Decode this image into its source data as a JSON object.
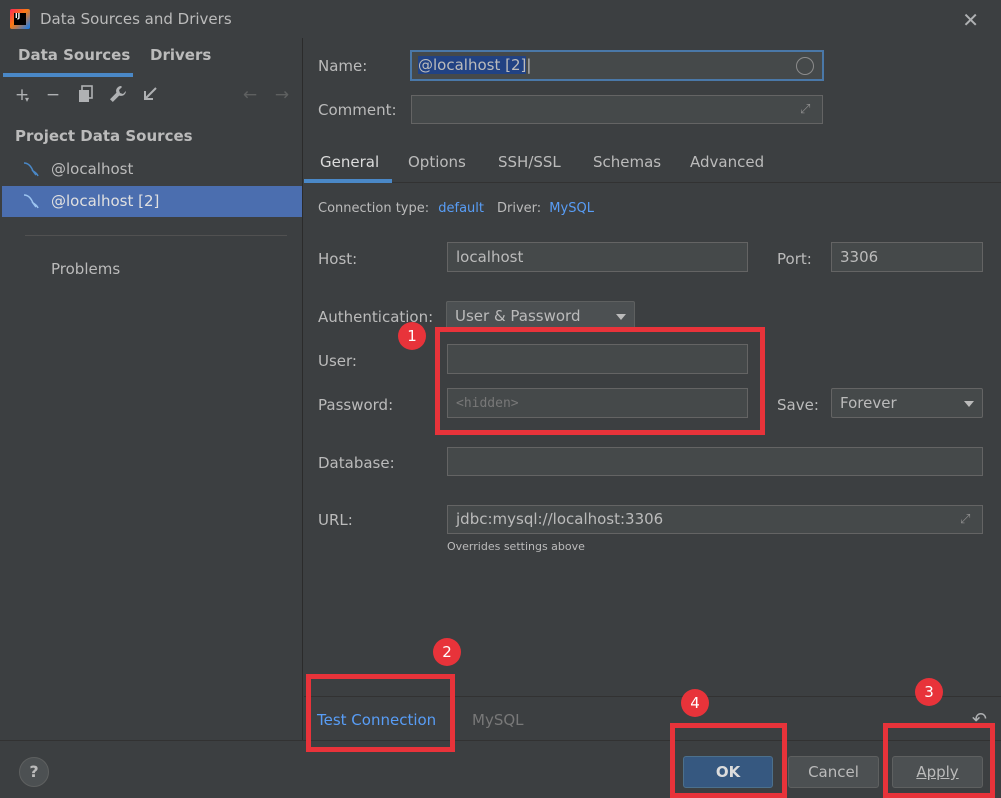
{
  "window": {
    "title": "Data Sources and Drivers"
  },
  "left_tabs": [
    "Data Sources",
    "Drivers"
  ],
  "section_title": "Project Data Sources",
  "data_sources": [
    {
      "label": "@localhost",
      "selected": false
    },
    {
      "label": "@localhost [2]",
      "selected": true
    }
  ],
  "problems_label": "Problems",
  "form": {
    "name_label": "Name:",
    "name_value": "@localhost [2]",
    "comment_label": "Comment:",
    "comment_value": ""
  },
  "right_tabs": [
    "General",
    "Options",
    "SSH/SSL",
    "Schemas",
    "Advanced"
  ],
  "active_tab": "General",
  "connection": {
    "type_label": "Connection type:",
    "type_value": "default",
    "driver_label": "Driver:",
    "driver_value": "MySQL"
  },
  "general": {
    "host_label": "Host:",
    "host_value": "localhost",
    "port_label": "Port:",
    "port_value": "3306",
    "auth_label": "Authentication:",
    "auth_value": "User & Password",
    "user_label": "User:",
    "user_value": "",
    "password_label": "Password:",
    "password_placeholder": "<hidden>",
    "save_label": "Save:",
    "save_value": "Forever",
    "database_label": "Database:",
    "database_value": "",
    "url_label": "URL:",
    "url_value": "jdbc:mysql://localhost:3306",
    "url_hint": "Overrides settings above"
  },
  "bottom": {
    "test_connection": "Test Connection",
    "driver_name": "MySQL"
  },
  "footer": {
    "help": "?",
    "ok": "OK",
    "cancel": "Cancel",
    "apply": "Apply"
  },
  "annotations": [
    "1",
    "2",
    "3",
    "4"
  ],
  "colors": {
    "background": "#3c3f41",
    "accent": "#4a88c7",
    "selection": "#4b6eaf",
    "link": "#589df6",
    "annotation": "#e8333a"
  }
}
